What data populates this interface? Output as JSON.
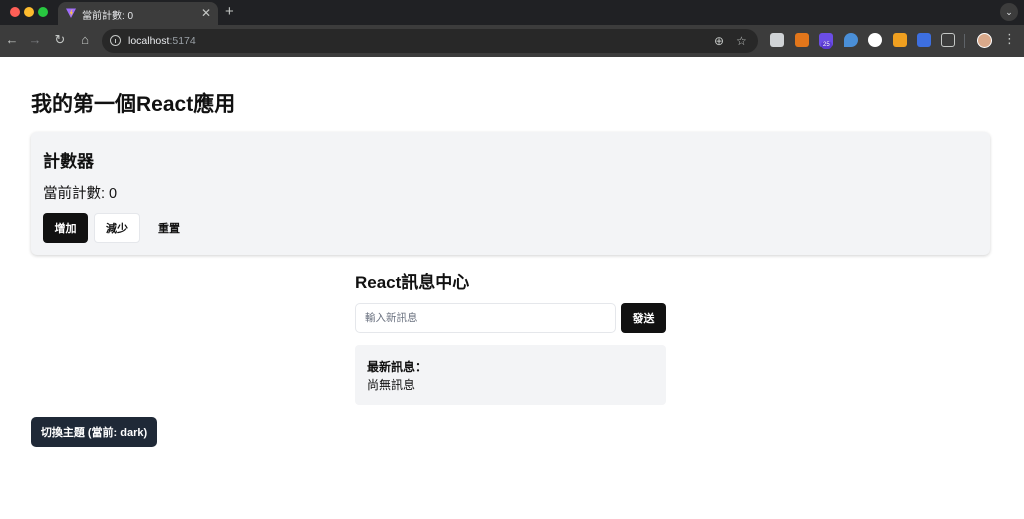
{
  "browser": {
    "tab_title": "當前計數: 0",
    "url_host": "localhost",
    "url_port": ":5174",
    "ext_badge": "25"
  },
  "page": {
    "title": "我的第一個React應用"
  },
  "counter": {
    "title": "計數器",
    "count_text": "當前計數: 0",
    "increment_label": "增加",
    "decrement_label": "減少",
    "reset_label": "重置"
  },
  "messages": {
    "title": "React訊息中心",
    "input_placeholder": "輸入新訊息",
    "input_value": "",
    "send_label": "發送",
    "latest_label": "最新訊息：",
    "latest_text": "尚無訊息"
  },
  "theme": {
    "toggle_label": "切換主題 (當前: dark)"
  },
  "colors": {
    "primary_button": "#111111",
    "theme_button": "#1f2937",
    "card_background": "#f3f4f6"
  }
}
